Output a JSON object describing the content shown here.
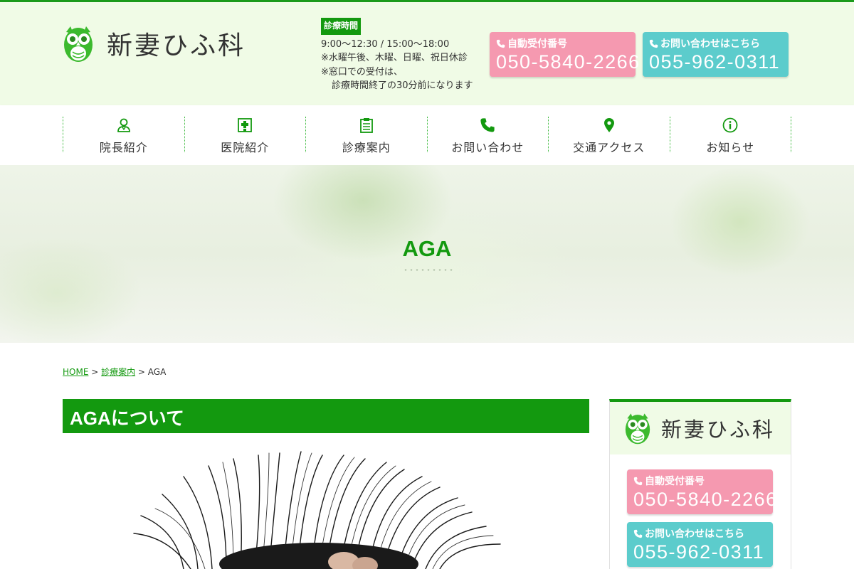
{
  "clinic": {
    "name": "新妻ひふ科"
  },
  "hours": {
    "badge": "診療時間",
    "line1": "9:00〜12:30 / 15:00〜18:00",
    "line2": "※水曜午後、木曜、日曜、祝日休診",
    "line3": "※窓口での受付は、",
    "line4": "診療時間終了の30分前になります"
  },
  "phones": {
    "auto": {
      "label": "自動受付番号",
      "number": "050-5840-2266"
    },
    "inquiry": {
      "label": "お問い合わせはこちら",
      "number": "055-962-0311"
    }
  },
  "nav": {
    "items": [
      {
        "label": "院長紹介",
        "icon": "doctor-icon"
      },
      {
        "label": "医院紹介",
        "icon": "hospital-icon"
      },
      {
        "label": "診療案内",
        "icon": "clipboard-icon"
      },
      {
        "label": "お問い合わせ",
        "icon": "phone-icon"
      },
      {
        "label": "交通アクセス",
        "icon": "map-pin-icon"
      },
      {
        "label": "お知らせ",
        "icon": "info-icon"
      }
    ]
  },
  "hero": {
    "title": "AGA"
  },
  "breadcrumb": {
    "home": "HOME",
    "sep1": " > ",
    "parent": "診療案内",
    "sep2": " > ",
    "current": "AGA"
  },
  "main": {
    "section_title": "AGAについて"
  },
  "colors": {
    "brand_green": "#13990f",
    "header_bg": "#f0fbe6",
    "pink": "#f599b0",
    "cyan": "#5ccccc"
  }
}
